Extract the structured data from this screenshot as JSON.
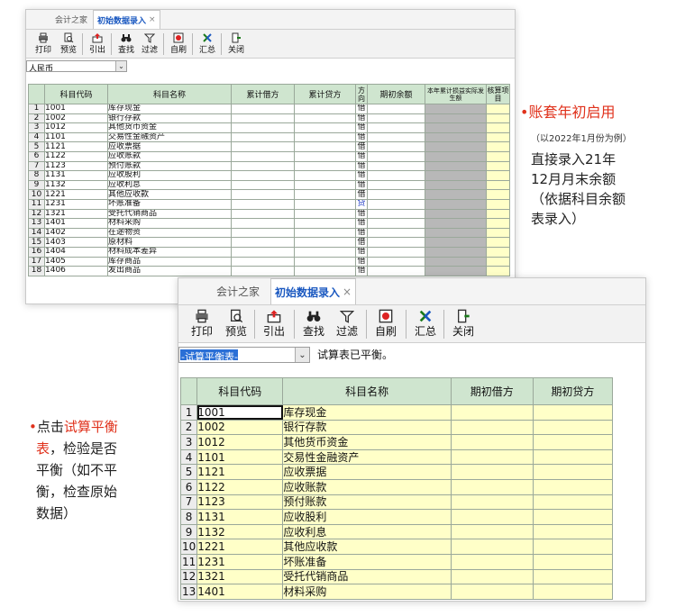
{
  "tabs": {
    "home": "会计之家",
    "active": "初始数据录入",
    "close": "×"
  },
  "toolbar": {
    "print": "打印",
    "preview": "预览",
    "export": "引出",
    "find": "查找",
    "filter": "过滤",
    "autorefresh": "自刷",
    "summary": "汇总",
    "close": "关闭"
  },
  "window1": {
    "currency": "人民币",
    "headers": {
      "code": "科目代码",
      "name": "科目名称",
      "debit": "累计借方",
      "credit": "累计贷方",
      "direction": "方向",
      "opening": "期初余额",
      "pl": "本年累计损益实际发生额",
      "check": "核算项目"
    },
    "rows": [
      {
        "n": "1",
        "code": "1001",
        "name": "库存现金",
        "dir": "借"
      },
      {
        "n": "2",
        "code": "1002",
        "name": "银行存款",
        "dir": "借"
      },
      {
        "n": "3",
        "code": "1012",
        "name": "其他货币资金",
        "dir": "借"
      },
      {
        "n": "4",
        "code": "1101",
        "name": "交易性金融资产",
        "dir": "借"
      },
      {
        "n": "5",
        "code": "1121",
        "name": "应收票据",
        "dir": "借"
      },
      {
        "n": "6",
        "code": "1122",
        "name": "应收账款",
        "dir": "借"
      },
      {
        "n": "7",
        "code": "1123",
        "name": "预付账款",
        "dir": "借"
      },
      {
        "n": "8",
        "code": "1131",
        "name": "应收股利",
        "dir": "借"
      },
      {
        "n": "9",
        "code": "1132",
        "name": "应收利息",
        "dir": "借"
      },
      {
        "n": "10",
        "code": "1221",
        "name": "其他应收款",
        "dir": "借"
      },
      {
        "n": "11",
        "code": "1231",
        "name": "坏账准备",
        "dir": "贷"
      },
      {
        "n": "12",
        "code": "1321",
        "name": "受托代销商品",
        "dir": "借"
      },
      {
        "n": "13",
        "code": "1401",
        "name": "材料采购",
        "dir": "借"
      },
      {
        "n": "14",
        "code": "1402",
        "name": "在途物资",
        "dir": "借"
      },
      {
        "n": "15",
        "code": "1403",
        "name": "原材料",
        "dir": "借"
      },
      {
        "n": "16",
        "code": "1404",
        "name": "材料成本差异",
        "dir": "借"
      },
      {
        "n": "17",
        "code": "1405",
        "name": "库存商品",
        "dir": "借"
      },
      {
        "n": "18",
        "code": "1406",
        "name": "发出商品",
        "dir": "借"
      }
    ]
  },
  "window2": {
    "selector": "-试算平衡表-",
    "status": "试算表已平衡。",
    "headers": {
      "code": "科目代码",
      "name": "科目名称",
      "opening_debit": "期初借方",
      "opening_credit": "期初贷方"
    },
    "rows": [
      {
        "n": "1",
        "code": "1001",
        "name": "库存现金"
      },
      {
        "n": "2",
        "code": "1002",
        "name": "银行存款"
      },
      {
        "n": "3",
        "code": "1012",
        "name": "其他货币资金"
      },
      {
        "n": "4",
        "code": "1101",
        "name": "交易性金融资产"
      },
      {
        "n": "5",
        "code": "1121",
        "name": "应收票据"
      },
      {
        "n": "6",
        "code": "1122",
        "name": "应收账款"
      },
      {
        "n": "7",
        "code": "1123",
        "name": "预付账款"
      },
      {
        "n": "8",
        "code": "1131",
        "name": "应收股利"
      },
      {
        "n": "9",
        "code": "1132",
        "name": "应收利息"
      },
      {
        "n": "10",
        "code": "1221",
        "name": "其他应收款"
      },
      {
        "n": "11",
        "code": "1231",
        "name": "坏账准备"
      },
      {
        "n": "12",
        "code": "1321",
        "name": "受托代销商品"
      },
      {
        "n": "13",
        "code": "1401",
        "name": "材料采购"
      }
    ]
  },
  "annotation_right": {
    "bullet": "•",
    "title": "账套年初启用",
    "note": "（以2022年1月份为例）",
    "lines": [
      "直接录入21年",
      "12月月末余额",
      "（依据科目余额",
      "表录入）"
    ]
  },
  "annotation_left": {
    "bullet": "•",
    "prefix": "点击",
    "link": "试算平衡",
    "line2_red": "表",
    "line2_rest": "，检验是否",
    "lines": [
      "平衡（如不平",
      "衡，检查原始",
      "数据）"
    ]
  },
  "colors": {
    "accent_red": "#e0321c",
    "tab_blue": "#1a58c0",
    "yellow_cell": "#ffffc8",
    "gray_cell": "#b8b8b8",
    "header_green": "#cfe5cf"
  }
}
